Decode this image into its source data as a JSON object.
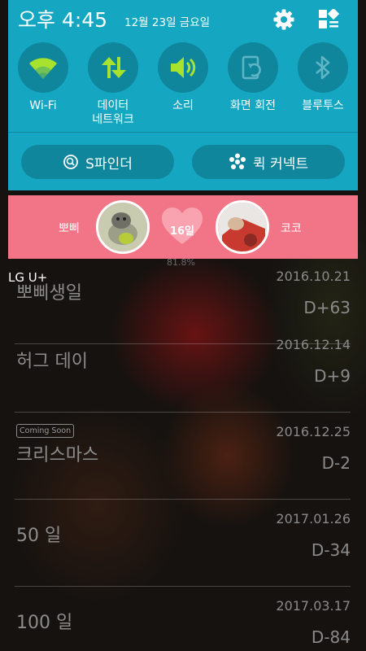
{
  "status_bar": {
    "time": "오후 4:45",
    "date": "12월 23일 금요일",
    "settings_icon": "gear-icon",
    "edit_icon": "grid-edit-icon"
  },
  "quick_toggles": [
    {
      "label": "Wi-Fi",
      "icon": "wifi-icon",
      "active": true
    },
    {
      "label": "데이터\n네트워크",
      "icon": "data-arrows-icon",
      "active": true
    },
    {
      "label": "소리",
      "icon": "speaker-icon",
      "active": true
    },
    {
      "label": "화면 회전",
      "icon": "rotate-icon",
      "active": false
    },
    {
      "label": "블루투스",
      "icon": "bluetooth-icon",
      "active": false
    }
  ],
  "shade_buttons": {
    "s_finder": "S파인더",
    "quick_connect": "퀵 커넥트"
  },
  "couple_widget": {
    "left_name": "뽀삐",
    "right_name": "코코",
    "days": "16일"
  },
  "carrier": "LG U+",
  "background": {
    "percent": "81.8%",
    "events": [
      {
        "name": "뽀삐생일",
        "date": "2016.10.21",
        "dday": "D+63",
        "badge": ""
      },
      {
        "name": "허그 데이",
        "date": "2016.12.14",
        "dday": "D+9",
        "badge": ""
      },
      {
        "name": "크리스마스",
        "date": "2016.12.25",
        "dday": "D-2",
        "badge": "Coming Soon"
      },
      {
        "name": "50 일",
        "date": "2017.01.26",
        "dday": "D-34",
        "badge": ""
      },
      {
        "name": "100 일",
        "date": "2017.03.17",
        "dday": "D-84",
        "badge": ""
      }
    ]
  },
  "colors": {
    "shade": "#15a7c2",
    "toggle_circle": "#0f869c",
    "active_icon": "#a6e22e",
    "inactive_icon": "#5fb5c6",
    "couple_bar": "#f17586"
  }
}
